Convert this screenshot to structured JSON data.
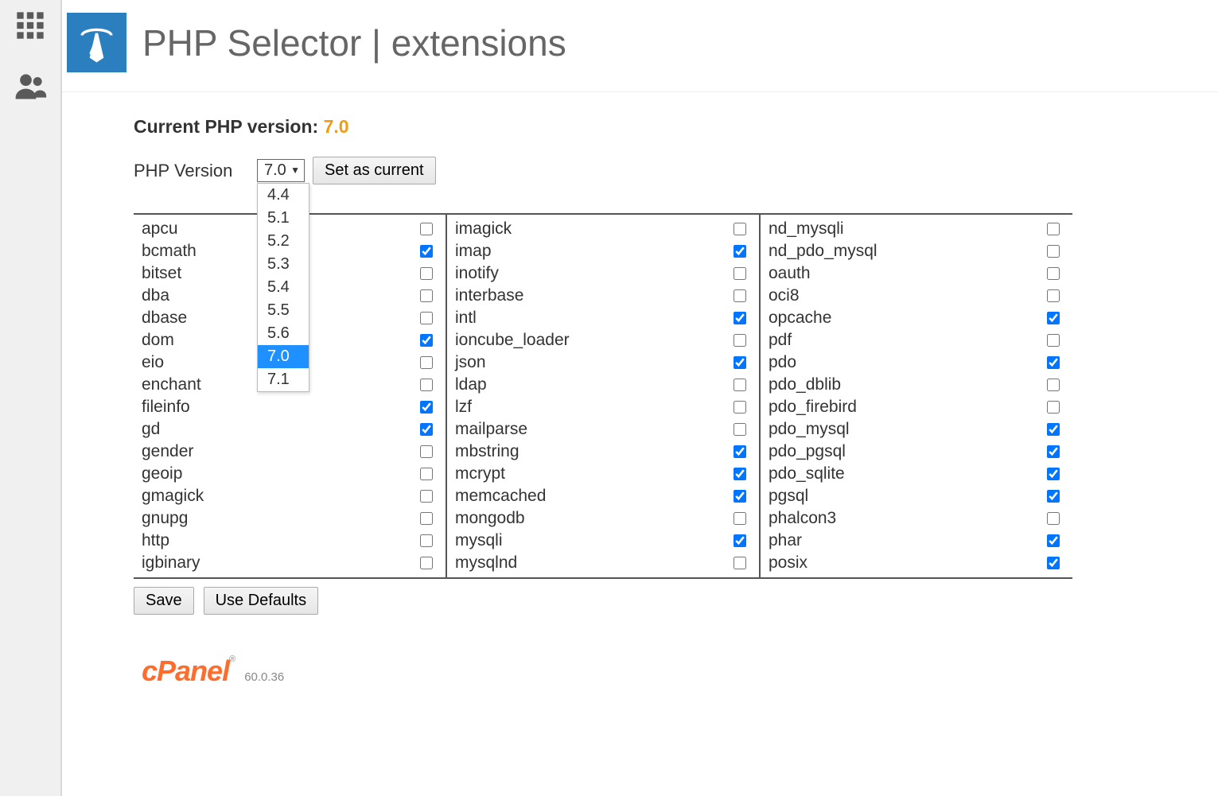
{
  "page": {
    "title": "PHP Selector | extensions"
  },
  "current": {
    "label": "Current PHP version:",
    "version": "7.0"
  },
  "selector": {
    "label": "PHP Version",
    "selected": "7.0",
    "options": [
      "4.4",
      "5.1",
      "5.2",
      "5.3",
      "5.4",
      "5.5",
      "5.6",
      "7.0",
      "7.1"
    ],
    "set_button": "Set as current"
  },
  "extensions": {
    "col1": [
      {
        "name": "apcu",
        "checked": false
      },
      {
        "name": "bcmath",
        "checked": true
      },
      {
        "name": "bitset",
        "checked": false
      },
      {
        "name": "dba",
        "checked": false
      },
      {
        "name": "dbase",
        "checked": false
      },
      {
        "name": "dom",
        "checked": true
      },
      {
        "name": "eio",
        "checked": false
      },
      {
        "name": "enchant",
        "checked": false
      },
      {
        "name": "fileinfo",
        "checked": true
      },
      {
        "name": "gd",
        "checked": true
      },
      {
        "name": "gender",
        "checked": false
      },
      {
        "name": "geoip",
        "checked": false
      },
      {
        "name": "gmagick",
        "checked": false
      },
      {
        "name": "gnupg",
        "checked": false
      },
      {
        "name": "http",
        "checked": false
      },
      {
        "name": "igbinary",
        "checked": false
      }
    ],
    "col2": [
      {
        "name": "imagick",
        "checked": false
      },
      {
        "name": "imap",
        "checked": true
      },
      {
        "name": "inotify",
        "checked": false
      },
      {
        "name": "interbase",
        "checked": false
      },
      {
        "name": "intl",
        "checked": true
      },
      {
        "name": "ioncube_loader",
        "checked": false
      },
      {
        "name": "json",
        "checked": true
      },
      {
        "name": "ldap",
        "checked": false
      },
      {
        "name": "lzf",
        "checked": false
      },
      {
        "name": "mailparse",
        "checked": false
      },
      {
        "name": "mbstring",
        "checked": true
      },
      {
        "name": "mcrypt",
        "checked": true
      },
      {
        "name": "memcached",
        "checked": true
      },
      {
        "name": "mongodb",
        "checked": false
      },
      {
        "name": "mysqli",
        "checked": true
      },
      {
        "name": "mysqlnd",
        "checked": false
      }
    ],
    "col3": [
      {
        "name": "nd_mysqli",
        "checked": false
      },
      {
        "name": "nd_pdo_mysql",
        "checked": false
      },
      {
        "name": "oauth",
        "checked": false
      },
      {
        "name": "oci8",
        "checked": false
      },
      {
        "name": "opcache",
        "checked": true
      },
      {
        "name": "pdf",
        "checked": false
      },
      {
        "name": "pdo",
        "checked": true
      },
      {
        "name": "pdo_dblib",
        "checked": false
      },
      {
        "name": "pdo_firebird",
        "checked": false
      },
      {
        "name": "pdo_mysql",
        "checked": true
      },
      {
        "name": "pdo_pgsql",
        "checked": true
      },
      {
        "name": "pdo_sqlite",
        "checked": true
      },
      {
        "name": "pgsql",
        "checked": true
      },
      {
        "name": "phalcon3",
        "checked": false
      },
      {
        "name": "phar",
        "checked": true
      },
      {
        "name": "posix",
        "checked": true
      }
    ]
  },
  "buttons": {
    "save": "Save",
    "defaults": "Use Defaults"
  },
  "footer": {
    "brand": "cPanel",
    "version": "60.0.36"
  }
}
